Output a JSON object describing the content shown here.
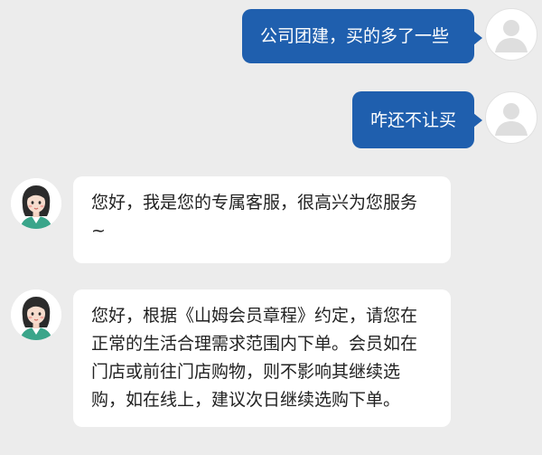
{
  "messages": [
    {
      "from": "user",
      "text": "公司团建，买的多了一些"
    },
    {
      "from": "user",
      "text": "咋还不让买"
    },
    {
      "from": "agent",
      "lines": [
        "您好，我是您的专属客服，很高兴为您服务",
        "~"
      ]
    },
    {
      "from": "agent",
      "lines": [
        "您好，根据《山姆会员章程》约定，请您在",
        "正常的生活合理需求范围内下单。会员如在",
        "门店或前往门店购物，则不影响其继续选",
        "购，如在线上，建议次日继续选购下单。"
      ]
    }
  ],
  "colors": {
    "background": "#ececec",
    "user_bubble": "#1f5fae",
    "agent_bubble": "#ffffff"
  },
  "icons": {
    "user_avatar": "default-person-avatar-icon",
    "agent_avatar": "customer-service-agent-avatar-icon"
  }
}
